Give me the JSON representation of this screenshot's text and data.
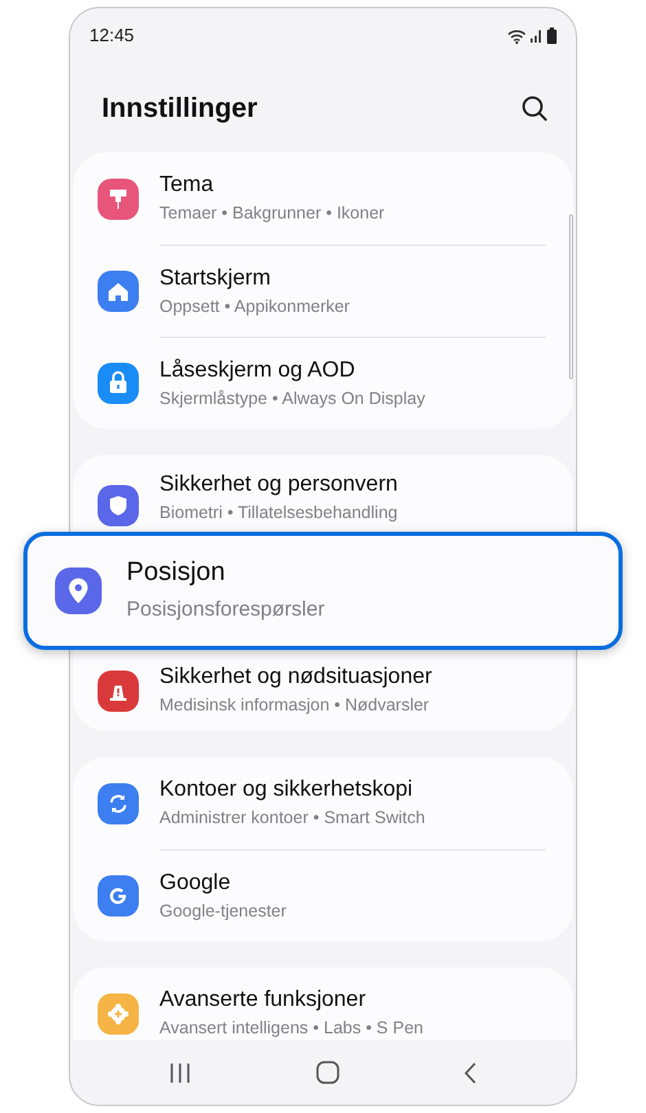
{
  "status_bar": {
    "time": "12:45"
  },
  "header": {
    "title": "Innstillinger"
  },
  "groups": [
    {
      "rows": [
        {
          "title": "Tema",
          "subtitle": "Temaer • Bakgrunner • Ikoner",
          "highlighted": false
        },
        {
          "title": "Startskjerm",
          "subtitle": "Oppsett • Appikonmerker",
          "highlighted": false
        },
        {
          "title": "Låseskjerm og AOD",
          "subtitle": "Skjermlåstype • Always On Display",
          "highlighted": false
        }
      ]
    },
    {
      "rows": [
        {
          "title": "Sikkerhet og personvern",
          "subtitle": "Biometri • Tillatelsesbehandling",
          "highlighted": false
        },
        {
          "title": "Posisjon",
          "subtitle": "Posisjonsforespørsler",
          "highlighted": true
        },
        {
          "title": "Sikkerhet og nødsituasjoner",
          "subtitle": "Medisinsk informasjon • Nødvarsler",
          "highlighted": false
        }
      ]
    },
    {
      "rows": [
        {
          "title": "Kontoer og sikkerhetskopi",
          "subtitle": "Administrer kontoer • Smart Switch",
          "highlighted": false
        },
        {
          "title": "Google",
          "subtitle": "Google-tjenester",
          "highlighted": false
        }
      ]
    },
    {
      "rows": [
        {
          "title": "Avanserte funksjoner",
          "subtitle": "Avansert intelligens • Labs • S Pen",
          "highlighted": false
        }
      ]
    }
  ]
}
